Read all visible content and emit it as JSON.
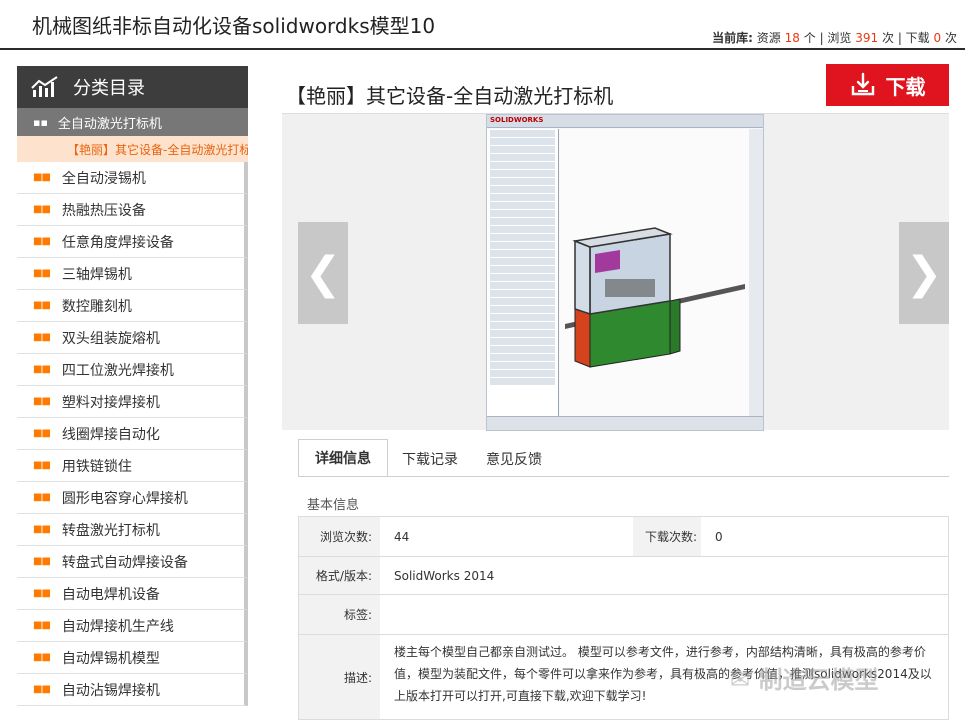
{
  "header": {
    "title": "机械图纸非标自动化设备solidwordks模型10",
    "stats": {
      "label": "当前库:",
      "res_prefix": "资源",
      "res_count": "18",
      "res_unit": "个 | 浏览",
      "view_count": "391",
      "view_unit": "次 | 下载",
      "dl_count": "0",
      "dl_unit": "次"
    }
  },
  "sidebar": {
    "title": "分类目录",
    "active_category": "全自动激光打标机",
    "active_sub": "【艳丽】其它设备-全自动激光打标机",
    "items": [
      "全自动浸锡机",
      "热融热压设备",
      "任意角度焊接设备",
      "三轴焊锡机",
      "数控雕刻机",
      "双头组装旋熔机",
      "四工位激光焊接机",
      "塑料对接焊接机",
      "线圈焊接自动化",
      "用铁链锁住",
      "圆形电容穿心焊接机",
      "转盘激光打标机",
      "转盘式自动焊接设备",
      "自动电焊机设备",
      "自动焊接机生产线",
      "自动焊锡机模型",
      "自动沾锡焊接机"
    ]
  },
  "main": {
    "title": "【艳丽】其它设备-全自动激光打标机",
    "download_label": "下载",
    "gallery": {
      "prev_label": "❮",
      "next_label": "❯",
      "screenshot_brand": "SOLIDWORKS"
    },
    "tabs": [
      "详细信息",
      "下载记录",
      "意见反馈"
    ],
    "section_label": "基本信息",
    "info": {
      "views_label": "浏览次数:",
      "views_value": "44",
      "downloads_label": "下载次数:",
      "downloads_value": "0",
      "format_label": "格式/版本:",
      "format_value": "SolidWorks 2014",
      "tags_label": "标签:",
      "tags_value": "",
      "desc_label": "描述:",
      "desc_value": "楼主每个模型自己都亲自测试过。 模型可以参考文件，进行参考，内部结构清晰，具有极高的参考价值，模型为装配文件，每个零件可以拿来作为参考，具有极高的参考价值，推测solidworks2014及以上版本打开可以打开,可直接下载,欢迎下载学习!"
    }
  },
  "watermark": "制造云模型",
  "colors": {
    "accent": "#e0141e",
    "header_dark": "#3d3d3d",
    "highlight": "#e8380d",
    "bullet": "#ff7a00"
  }
}
